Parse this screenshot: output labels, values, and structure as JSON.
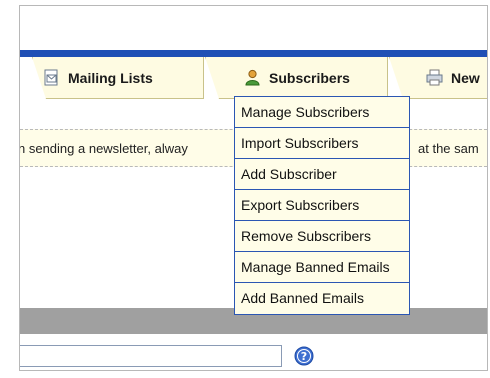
{
  "tabs": {
    "mailing_lists": "Mailing Lists",
    "subscribers": "Subscribers",
    "newsletters_partial": "New"
  },
  "notice": {
    "text_left": "n sending a newsletter, alway",
    "text_right": "at the sam"
  },
  "menu": {
    "items": [
      "Manage Subscribers",
      "Import Subscribers",
      "Add Subscriber",
      "Export Subscribers",
      "Remove Subscribers",
      "Manage Banned Emails",
      "Add Banned Emails"
    ]
  },
  "search": {
    "value": ""
  },
  "icons": {
    "mailing_lists": "mailing-lists-icon",
    "subscribers": "subscriber-person-icon",
    "newsletters": "newsletter-printer-icon",
    "help": "help-question-icon"
  },
  "colors": {
    "nav_bar": "#1f4fb5",
    "tab_background": "#fefbe2",
    "menu_border": "#2b56b3",
    "toolbar_gray": "#a0a0a0"
  }
}
